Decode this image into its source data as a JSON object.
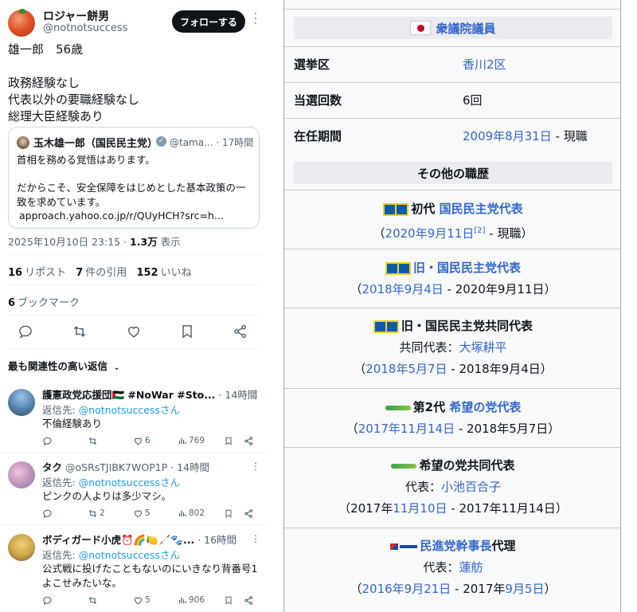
{
  "tweet": {
    "author_name": "ロジャー餅男",
    "author_handle": "@notnotsuccess",
    "follow_label": "フォローする",
    "text_lines": [
      "雄一郎　56歳",
      "",
      "政務経験なし",
      "代表以外の要職経験なし",
      "総理大臣経験あり"
    ],
    "quote": {
      "name": "玉木雄一郎（国民民主党）",
      "handle": "@tama...",
      "time": "· 17時間",
      "lines": [
        "首相を務める覚悟はあります。",
        "",
        "だからこそ、安全保障をはじめとした基本政策の一",
        "致を求めています。",
        "approach.yahoo.co.jp/r/QUyHCH?src=h..."
      ]
    },
    "timestamp": "2025年10月10日 23:15 · ",
    "views_count": "1.3万",
    "views_label": " 表示",
    "reposts_count": "16",
    "reposts_label": "リポスト",
    "quotes_count": "7",
    "quotes_label": "件の引用",
    "likes_count": "152",
    "likes_label": "いいね",
    "bookmarks_count": "6",
    "bookmarks_label": "ブックマーク",
    "replies_sort_label": "最も関連性の高い返信"
  },
  "replies": [
    {
      "name": "護憲政党応援団🇵🇸 #NoWar #Sto...",
      "time": " · 14時間",
      "reply_to_prefix": "返信先: ",
      "reply_to": "@notnotsuccessさん",
      "text": "不倫経験あり",
      "reposts": "",
      "likes": "6",
      "views": "769",
      "avatar_color": "#6f8fb6"
    },
    {
      "name": "タク",
      "time": " @oSRsTJIBK7WOP1P · 14時間",
      "reply_to_prefix": "返信先: ",
      "reply_to": "@notnotsuccessさん",
      "text": "ピンクの人よりは多少マシ。",
      "reposts": "2",
      "likes": "5",
      "views": "802",
      "avatar_color": "#b98fb8"
    },
    {
      "name": "ボディガード小虎⏰🌈🍋🦯🐾...",
      "time": " · 16時間",
      "reply_to_prefix": "返信先: ",
      "reply_to": "@notnotsuccessさん",
      "text": "公式戦に投げたこともないのにいきなり背番号1よこせみたいな。",
      "reposts": "",
      "likes": "5",
      "views": "906",
      "avatar_color": "#c9a34a"
    }
  ],
  "infobox": {
    "header": "衆議院議員",
    "rows": [
      {
        "label": "選挙区",
        "value_link": "香川2区",
        "value_text": ""
      },
      {
        "label": "当選回数",
        "value_link": "",
        "value_text": "6回"
      },
      {
        "label": "在任期間",
        "value_link": "2009年8月31日",
        "value_text": " - 現職"
      }
    ],
    "other_header": "その他の職歴",
    "positions": [
      {
        "prefix": "初代 ",
        "title_link": "国民民主党代表",
        "title_text": "",
        "period_open": "（",
        "period_link": "2020年9月11日",
        "period_sup": "[2]",
        "period_rest": " - 現職）"
      },
      {
        "prefix": "",
        "title_link": "旧・国民民主党代表",
        "title_text": "",
        "period_open": "（",
        "period_link": "2018年9月4日",
        "period_rest": " - 2020年9月11日）"
      },
      {
        "prefix": "",
        "title_link": "",
        "title_text": "旧・国民民主党共同代表",
        "sub_label": "共同代表：",
        "sub_link": "大塚耕平",
        "period_open": "（",
        "period_link": "2018年5月7日",
        "period_rest": " - 2018年9月4日）"
      },
      {
        "prefix": "第2代 ",
        "title_link": "希望の党代表",
        "title_text": "",
        "period_open": "（",
        "period_link": "2017年11月14日",
        "period_rest": " - 2018年5月7日）"
      },
      {
        "prefix": "",
        "title_link": "",
        "title_text": "希望の党共同代表",
        "sub_label": "代表：",
        "sub_link": "小池百合子",
        "period_open": "（2017年",
        "period_link": "11月10日",
        "period_rest": " - 2017年11月14日）"
      },
      {
        "prefix": "",
        "title_link": "民進党幹事長",
        "title_text": "代理",
        "sub_label": "代表：",
        "sub_link": "蓮舫",
        "period_open": "（",
        "period_link": "2016年9月21日",
        "period_mid": " - 2017年",
        "period_link2": "9月5日",
        "period_rest": "）"
      }
    ]
  },
  "icons": {
    "reply": "speech-bubble-icon",
    "repost": "repost-arrows-icon",
    "like": "heart-icon",
    "bookmark": "bookmark-icon",
    "share": "share-icon",
    "views": "bar-chart-icon"
  },
  "colors": {
    "link": "#3366cc",
    "mention": "#1d9bf0",
    "follow_bg": "#0f1419",
    "infobox_bg": "#f8f9fa",
    "header_bg": "#eaecf0"
  }
}
